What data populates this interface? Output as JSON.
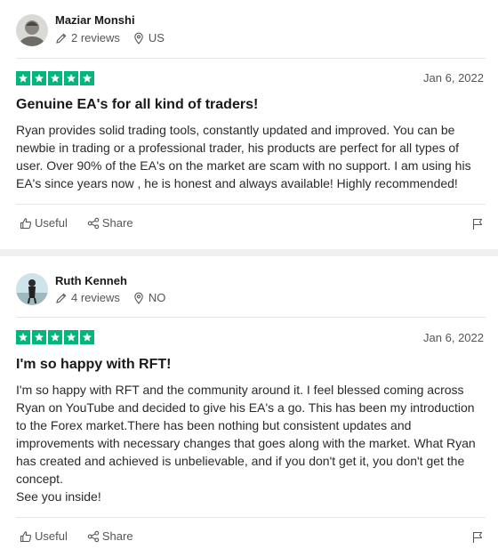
{
  "reviews": [
    {
      "reviewer_name": "Maziar Monshi",
      "review_count": "2 reviews",
      "country": "US",
      "rating": 5,
      "date": "Jan 6, 2022",
      "title": "Genuine EA's for all kind of traders!",
      "body": [
        "Ryan provides solid trading tools, constantly updated and improved. You can be newbie in trading or a professional trader, his products are perfect for all types of user. Over 90% of the EA's on the market are scam with no support. I am using his EA's since years now , he is honest and always available! Highly recommended!"
      ],
      "useful_label": "Useful",
      "share_label": "Share"
    },
    {
      "reviewer_name": "Ruth Kenneh",
      "review_count": "4 reviews",
      "country": "NO",
      "rating": 5,
      "date": "Jan 6, 2022",
      "title": "I'm so happy with RFT!",
      "body": [
        "I'm so happy with RFT and the community around it. I feel blessed coming across Ryan on YouTube and decided to give his EA's a go. This has been my introduction to the Forex market.There has been nothing but consistent updates and improvements with necessary changes that goes along with the market. What Ryan has created and achieved is unbelievable, and if you don't get it, you don't get the concept.",
        "See you inside!"
      ],
      "useful_label": "Useful",
      "share_label": "Share"
    }
  ],
  "colors": {
    "star_green": "#00b67a",
    "separator": "#f0f0f3"
  },
  "icons": {
    "reviews": "pencil-icon",
    "location": "location-pin-icon",
    "useful": "thumbs-up-icon",
    "share": "share-icon",
    "report": "flag-icon"
  }
}
